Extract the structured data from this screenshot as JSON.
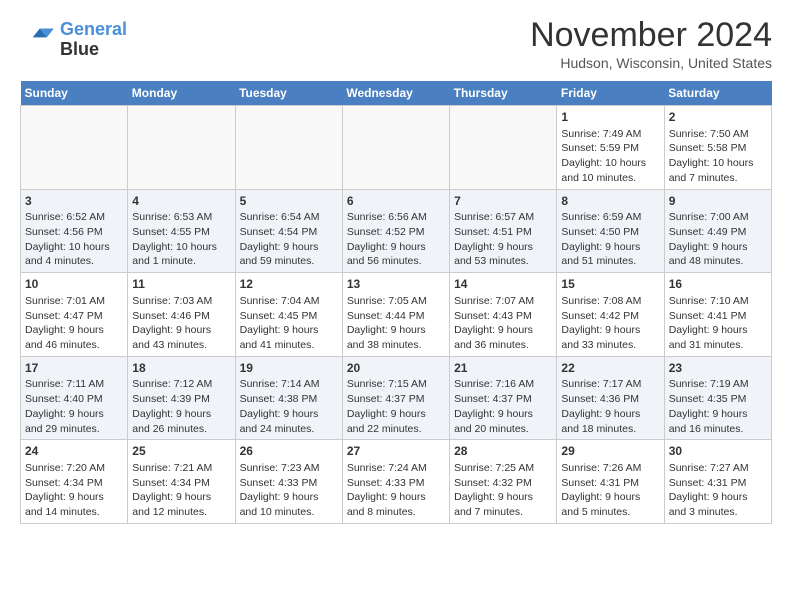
{
  "header": {
    "logo_line1": "General",
    "logo_line2": "Blue",
    "month": "November 2024",
    "location": "Hudson, Wisconsin, United States"
  },
  "weekdays": [
    "Sunday",
    "Monday",
    "Tuesday",
    "Wednesday",
    "Thursday",
    "Friday",
    "Saturday"
  ],
  "weeks": [
    [
      {
        "day": "",
        "info": ""
      },
      {
        "day": "",
        "info": ""
      },
      {
        "day": "",
        "info": ""
      },
      {
        "day": "",
        "info": ""
      },
      {
        "day": "",
        "info": ""
      },
      {
        "day": "1",
        "info": "Sunrise: 7:49 AM\nSunset: 5:59 PM\nDaylight: 10 hours and 10 minutes."
      },
      {
        "day": "2",
        "info": "Sunrise: 7:50 AM\nSunset: 5:58 PM\nDaylight: 10 hours and 7 minutes."
      }
    ],
    [
      {
        "day": "3",
        "info": "Sunrise: 6:52 AM\nSunset: 4:56 PM\nDaylight: 10 hours and 4 minutes."
      },
      {
        "day": "4",
        "info": "Sunrise: 6:53 AM\nSunset: 4:55 PM\nDaylight: 10 hours and 1 minute."
      },
      {
        "day": "5",
        "info": "Sunrise: 6:54 AM\nSunset: 4:54 PM\nDaylight: 9 hours and 59 minutes."
      },
      {
        "day": "6",
        "info": "Sunrise: 6:56 AM\nSunset: 4:52 PM\nDaylight: 9 hours and 56 minutes."
      },
      {
        "day": "7",
        "info": "Sunrise: 6:57 AM\nSunset: 4:51 PM\nDaylight: 9 hours and 53 minutes."
      },
      {
        "day": "8",
        "info": "Sunrise: 6:59 AM\nSunset: 4:50 PM\nDaylight: 9 hours and 51 minutes."
      },
      {
        "day": "9",
        "info": "Sunrise: 7:00 AM\nSunset: 4:49 PM\nDaylight: 9 hours and 48 minutes."
      }
    ],
    [
      {
        "day": "10",
        "info": "Sunrise: 7:01 AM\nSunset: 4:47 PM\nDaylight: 9 hours and 46 minutes."
      },
      {
        "day": "11",
        "info": "Sunrise: 7:03 AM\nSunset: 4:46 PM\nDaylight: 9 hours and 43 minutes."
      },
      {
        "day": "12",
        "info": "Sunrise: 7:04 AM\nSunset: 4:45 PM\nDaylight: 9 hours and 41 minutes."
      },
      {
        "day": "13",
        "info": "Sunrise: 7:05 AM\nSunset: 4:44 PM\nDaylight: 9 hours and 38 minutes."
      },
      {
        "day": "14",
        "info": "Sunrise: 7:07 AM\nSunset: 4:43 PM\nDaylight: 9 hours and 36 minutes."
      },
      {
        "day": "15",
        "info": "Sunrise: 7:08 AM\nSunset: 4:42 PM\nDaylight: 9 hours and 33 minutes."
      },
      {
        "day": "16",
        "info": "Sunrise: 7:10 AM\nSunset: 4:41 PM\nDaylight: 9 hours and 31 minutes."
      }
    ],
    [
      {
        "day": "17",
        "info": "Sunrise: 7:11 AM\nSunset: 4:40 PM\nDaylight: 9 hours and 29 minutes."
      },
      {
        "day": "18",
        "info": "Sunrise: 7:12 AM\nSunset: 4:39 PM\nDaylight: 9 hours and 26 minutes."
      },
      {
        "day": "19",
        "info": "Sunrise: 7:14 AM\nSunset: 4:38 PM\nDaylight: 9 hours and 24 minutes."
      },
      {
        "day": "20",
        "info": "Sunrise: 7:15 AM\nSunset: 4:37 PM\nDaylight: 9 hours and 22 minutes."
      },
      {
        "day": "21",
        "info": "Sunrise: 7:16 AM\nSunset: 4:37 PM\nDaylight: 9 hours and 20 minutes."
      },
      {
        "day": "22",
        "info": "Sunrise: 7:17 AM\nSunset: 4:36 PM\nDaylight: 9 hours and 18 minutes."
      },
      {
        "day": "23",
        "info": "Sunrise: 7:19 AM\nSunset: 4:35 PM\nDaylight: 9 hours and 16 minutes."
      }
    ],
    [
      {
        "day": "24",
        "info": "Sunrise: 7:20 AM\nSunset: 4:34 PM\nDaylight: 9 hours and 14 minutes."
      },
      {
        "day": "25",
        "info": "Sunrise: 7:21 AM\nSunset: 4:34 PM\nDaylight: 9 hours and 12 minutes."
      },
      {
        "day": "26",
        "info": "Sunrise: 7:23 AM\nSunset: 4:33 PM\nDaylight: 9 hours and 10 minutes."
      },
      {
        "day": "27",
        "info": "Sunrise: 7:24 AM\nSunset: 4:33 PM\nDaylight: 9 hours and 8 minutes."
      },
      {
        "day": "28",
        "info": "Sunrise: 7:25 AM\nSunset: 4:32 PM\nDaylight: 9 hours and 7 minutes."
      },
      {
        "day": "29",
        "info": "Sunrise: 7:26 AM\nSunset: 4:31 PM\nDaylight: 9 hours and 5 minutes."
      },
      {
        "day": "30",
        "info": "Sunrise: 7:27 AM\nSunset: 4:31 PM\nDaylight: 9 hours and 3 minutes."
      }
    ]
  ]
}
